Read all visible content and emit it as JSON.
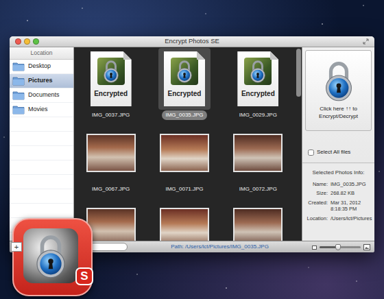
{
  "window": {
    "title": "Encrypt Photos SE"
  },
  "sidebar": {
    "header": "Location",
    "items": [
      {
        "label": "Desktop",
        "selected": false
      },
      {
        "label": "Pictures",
        "selected": true
      },
      {
        "label": "Documents",
        "selected": false
      },
      {
        "label": "Movies",
        "selected": false
      }
    ]
  },
  "photos": [
    {
      "label": "IMG_0037.JPG",
      "kind": "encrypted",
      "badge": "Encrypted",
      "selected": false
    },
    {
      "label": "IMG_0035.JPG",
      "kind": "encrypted",
      "badge": "Encrypted",
      "selected": true
    },
    {
      "label": "IMG_0029.JPG",
      "kind": "encrypted",
      "badge": "Encrypted",
      "selected": false
    },
    {
      "label": "IMG_0067.JPG",
      "kind": "photo",
      "selected": false
    },
    {
      "label": "IMG_0071.JPG",
      "kind": "photo",
      "selected": false
    },
    {
      "label": "IMG_0072.JPG",
      "kind": "photo",
      "selected": false
    },
    {
      "kind": "photo",
      "selected": false
    },
    {
      "kind": "photo",
      "selected": false
    },
    {
      "kind": "photo",
      "selected": false
    }
  ],
  "encrypt_button": {
    "label": "Click here ↑↑ to Encrypt/Decrypt"
  },
  "select_all": {
    "label": "Select All files",
    "checked": false
  },
  "info": {
    "title": "Selected Photos Info:",
    "fields": [
      {
        "label": "Name:",
        "value": [
          "IMG_0035.JPG"
        ]
      },
      {
        "label": "Size:",
        "value": [
          "268.82 KB"
        ]
      },
      {
        "label": "Created:",
        "value": [
          "Mar 31, 2012",
          "8:18:35 PM"
        ]
      },
      {
        "label": "Location:",
        "value": [
          "/Users/lct/Pictures"
        ]
      }
    ]
  },
  "bottom_bar": {
    "add": "+",
    "path": "Path: /Users/lct/Pictures/IMG_0035.JPG",
    "zoom_level": 0.45
  },
  "app_icon": {
    "badge": "S"
  }
}
